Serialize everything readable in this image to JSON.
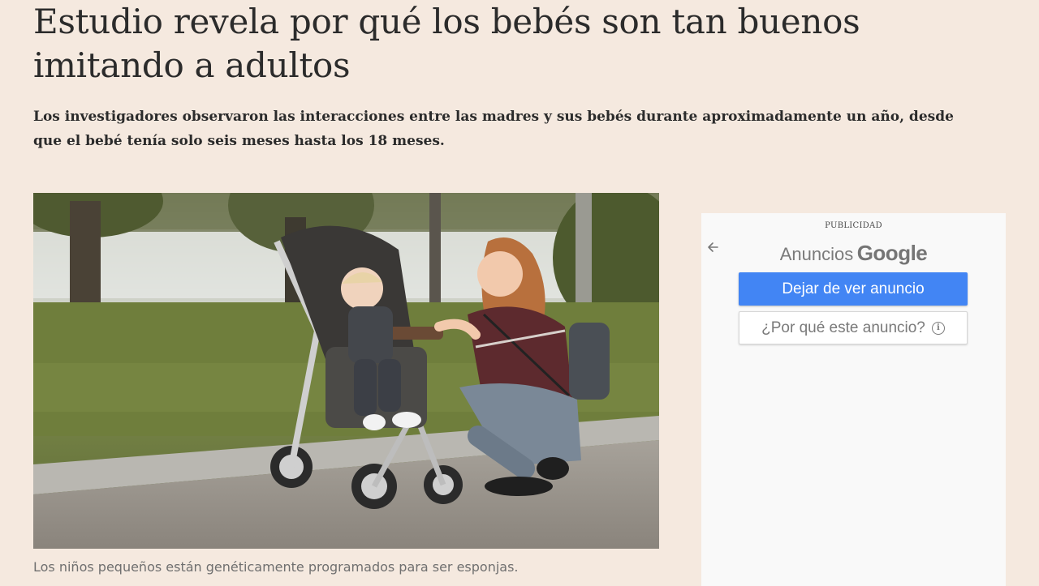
{
  "article": {
    "headline": "Estudio revela por qué los bebés son tan buenos imitando a adultos",
    "lede": "Los investigadores observaron las interacciones entre las madres y sus bebés durante aproximadamente un año, desde que el bebé tenía solo seis meses hasta los 18 meses.",
    "caption": "Los niños pequeños están genéticamente programados para ser esponjas."
  },
  "ad": {
    "label": "PUBLICIDAD",
    "brand_prefix": "Anuncios",
    "brand_name": "Google",
    "stop_button": "Dejar de ver anuncio",
    "why_button": "¿Por qué este anuncio?",
    "back_icon": "arrow-left-icon",
    "info_icon": "info-icon"
  },
  "colors": {
    "page_background": "#f5e9df",
    "ad_primary": "#4285f4",
    "caption_text": "#6f6f6f"
  }
}
